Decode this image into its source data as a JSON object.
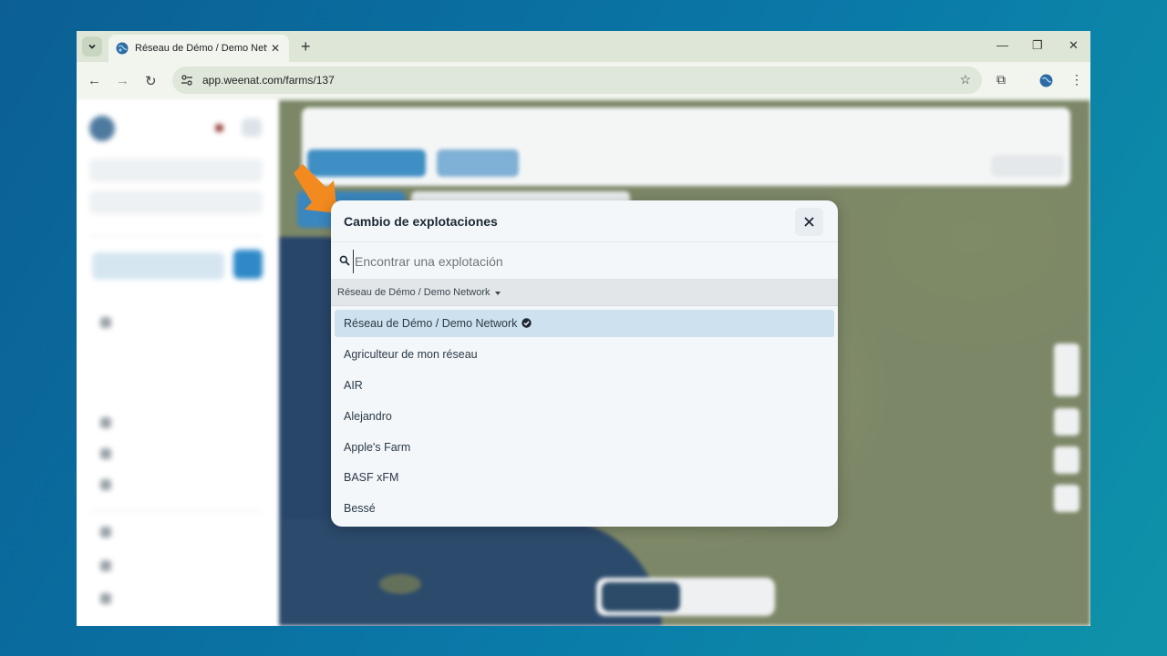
{
  "browser": {
    "tab_title": "Réseau de Démo / Demo Network",
    "url": "app.weenat.com/farms/137",
    "icons": [
      "chevron-down-icon",
      "globe-icon",
      "close-icon",
      "plus-icon",
      "minimize-icon",
      "restore-icon",
      "back-icon",
      "forward-icon",
      "reload-icon",
      "tune-icon",
      "star-icon",
      "extensions-icon",
      "profile-icon",
      "kebab-icon"
    ]
  },
  "modal": {
    "title": "Cambio de explotaciones",
    "search_placeholder": "Encontrar una explotación",
    "filter_label": "Réseau de Démo / Demo Network",
    "farms": [
      {
        "name": "Réseau de Démo / Demo Network",
        "selected": true,
        "verified": true
      },
      {
        "name": "Agriculteur de mon réseau",
        "selected": false,
        "verified": false
      },
      {
        "name": "AIR",
        "selected": false,
        "verified": false
      },
      {
        "name": "Alejandro",
        "selected": false,
        "verified": false
      },
      {
        "name": "Apple's Farm",
        "selected": false,
        "verified": false
      },
      {
        "name": "BASF xFM",
        "selected": false,
        "verified": false
      },
      {
        "name": "Bessé",
        "selected": false,
        "verified": false
      }
    ]
  },
  "colors": {
    "background_gradient": [
      "#0b5f94",
      "#0e93a9"
    ],
    "pointer": "#f28a1f",
    "selected_row": "#cde2ee"
  }
}
